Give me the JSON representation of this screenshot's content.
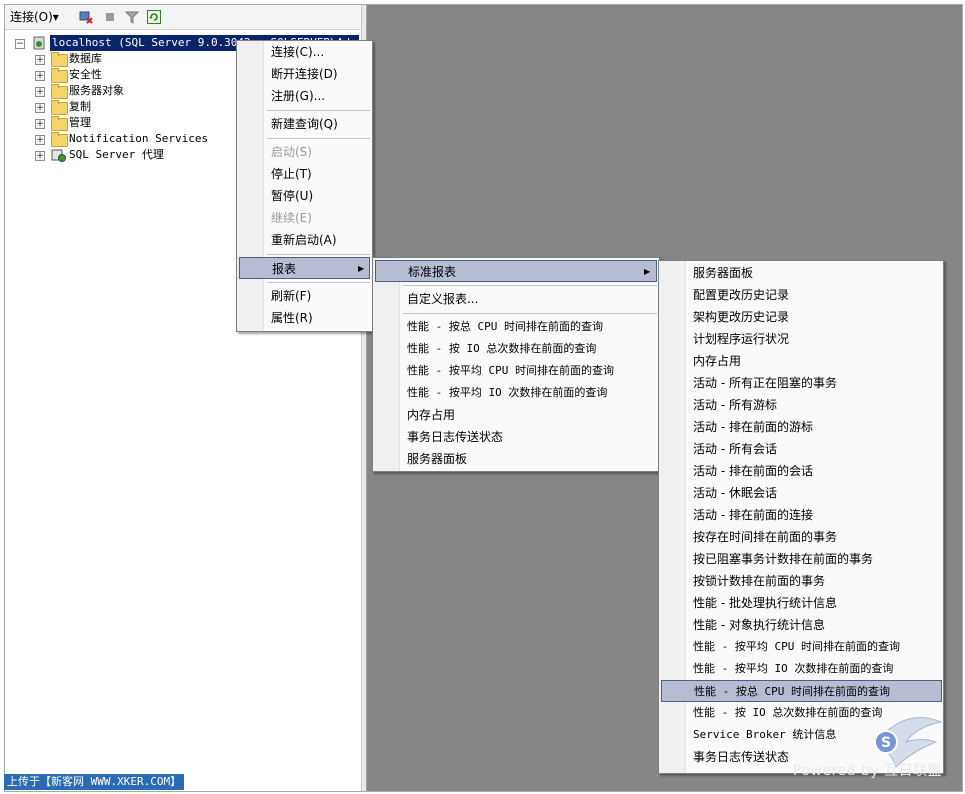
{
  "toolbar": {
    "connect_label": "连接(O)▾"
  },
  "tree": {
    "root": "localhost (SQL Server 9.0.3042 - SQLSERVER\\Admin)",
    "items": [
      "数据库",
      "安全性",
      "服务器对象",
      "复制",
      "管理",
      "Notification Services",
      "SQL Server 代理"
    ]
  },
  "context_menu": {
    "items": [
      {
        "label": "连接(C)...",
        "enabled": true
      },
      {
        "label": "断开连接(D)",
        "enabled": true
      },
      {
        "label": "注册(G)...",
        "enabled": true
      },
      {
        "label": "新建查询(Q)",
        "enabled": true
      },
      {
        "label": "启动(S)",
        "enabled": false
      },
      {
        "label": "停止(T)",
        "enabled": true
      },
      {
        "label": "暂停(U)",
        "enabled": true
      },
      {
        "label": "继续(E)",
        "enabled": false
      },
      {
        "label": "重新启动(A)",
        "enabled": true
      },
      {
        "label": "报表",
        "enabled": true,
        "selected": true
      },
      {
        "label": "刷新(F)",
        "enabled": true
      },
      {
        "label": "属性(R)",
        "enabled": true
      }
    ]
  },
  "reports_menu": {
    "items": [
      "标准报表",
      "自定义报表...",
      "性能 - 按总 CPU 时间排在前面的查询",
      "性能 - 按 IO 总次数排在前面的查询",
      "性能 - 按平均 CPU 时间排在前面的查询",
      "性能 - 按平均 IO 次数排在前面的查询",
      "内存占用",
      "事务日志传送状态",
      "服务器面板"
    ]
  },
  "standard_reports_menu": {
    "items": [
      "服务器面板",
      "配置更改历史记录",
      "架构更改历史记录",
      "计划程序运行状况",
      "内存占用",
      "活动 - 所有正在阻塞的事务",
      "活动 - 所有游标",
      "活动 - 排在前面的游标",
      "活动 - 所有会话",
      "活动 - 排在前面的会话",
      "活动 - 休眠会话",
      "活动 - 排在前面的连接",
      "按存在时间排在前面的事务",
      "按已阻塞事务计数排在前面的事务",
      "按锁计数排在前面的事务",
      "性能 - 批处理执行统计信息",
      "性能 - 对象执行统计信息",
      "性能 - 按平均 CPU 时间排在前面的查询",
      "性能 - 按平均 IO 次数排在前面的查询",
      "性能 - 按总 CPU 时间排在前面的查询",
      "性能 - 按 IO 总次数排在前面的查询",
      "Service Broker 统计信息",
      "事务日志传送状态"
    ],
    "selected_index": 19
  },
  "caption": "上传于【新客网 WWW.XKER.COM】",
  "watermark": "Powered by 互日联盟",
  "colors": {
    "selection": "#b6bdd2",
    "selection_border": "#4b5f8c",
    "background_gray": "#868686"
  }
}
